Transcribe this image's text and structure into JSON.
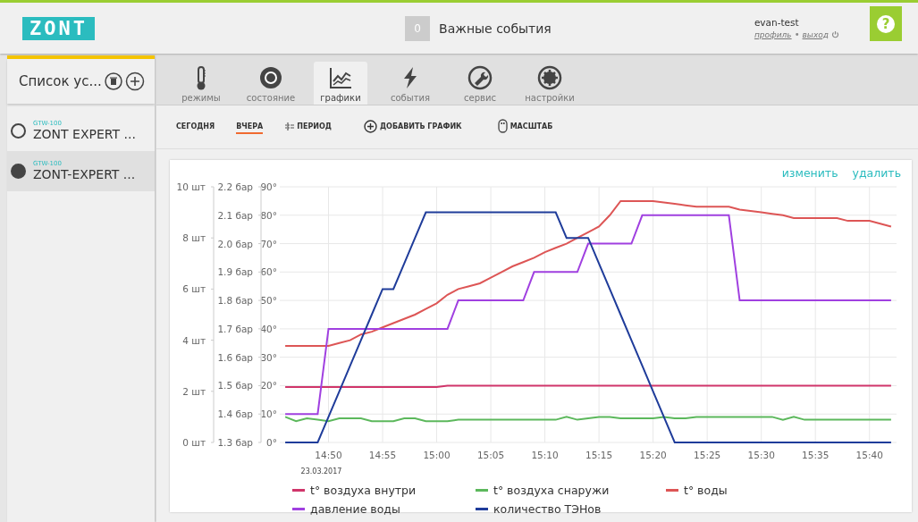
{
  "header": {
    "logo": "ZONT",
    "events": {
      "count": "0",
      "label": "Важные события"
    },
    "user": {
      "name": "evan-test",
      "profile_link": "профиль",
      "separator": "•",
      "logout_link": "выход"
    },
    "help": "?"
  },
  "sidebar": {
    "title": "Список ус...",
    "devices": [
      {
        "model": "GTW-100",
        "name": "ZONT EXPERT ...",
        "selected": false
      },
      {
        "model": "GTW-100",
        "name": "ZONT-EXPERT ...",
        "selected": true
      }
    ]
  },
  "tabs": [
    {
      "kind": "thermometer",
      "label": "режимы",
      "selected": false
    },
    {
      "kind": "status",
      "label": "состояние",
      "selected": false
    },
    {
      "kind": "chart",
      "label": "графики",
      "selected": true
    },
    {
      "kind": "bolt",
      "label": "события",
      "selected": false
    },
    {
      "kind": "wrench",
      "label": "сервис",
      "selected": false
    },
    {
      "kind": "gear",
      "label": "настройки",
      "selected": false
    }
  ],
  "toolbar": [
    {
      "kind": "plain",
      "label": "СЕГОДНЯ",
      "selected": false
    },
    {
      "kind": "plain",
      "label": "ВЧЕРА",
      "selected": true
    },
    {
      "kind": "period",
      "label": "ПЕРИОД",
      "selected": false
    },
    {
      "kind": "add",
      "label": "ДОБАВИТЬ ГРАФИК",
      "selected": false
    },
    {
      "kind": "zoom",
      "label": "МАСШТАБ",
      "selected": false
    }
  ],
  "chart_panel": {
    "actions": [
      "изменить",
      "удалить"
    ],
    "date_label": "23.03.2017",
    "chart_data": {
      "type": "line",
      "grid": true,
      "categories": [
        null,
        null,
        null,
        null,
        "14:50",
        null,
        null,
        null,
        null,
        "14:55",
        null,
        null,
        null,
        null,
        "15:00",
        null,
        null,
        null,
        null,
        "15:05",
        null,
        null,
        null,
        null,
        "15:10",
        null,
        null,
        null,
        null,
        "15:15",
        null,
        null,
        null,
        null,
        "15:20",
        null,
        null,
        null,
        null,
        "15:25",
        null,
        null,
        null,
        null,
        "15:30",
        null,
        null,
        null,
        null,
        "15:35",
        null,
        null,
        null,
        null,
        "15:40",
        null,
        null
      ],
      "ylim": [
        0,
        90
      ],
      "yticks": [
        {
          "value": 0,
          "label": "0°"
        },
        {
          "value": 10,
          "label": "10°"
        },
        {
          "value": 20,
          "label": "20°"
        },
        {
          "value": 30,
          "label": "30°"
        },
        {
          "value": 40,
          "label": "40°"
        },
        {
          "value": 50,
          "label": "50°"
        },
        {
          "value": 60,
          "label": "60°"
        },
        {
          "value": 70,
          "label": "70°"
        },
        {
          "value": 80,
          "label": "80°"
        },
        {
          "value": 90,
          "label": "90°"
        }
      ],
      "y2lim": [
        1.3,
        2.2
      ],
      "y2ticks": [
        {
          "value": 1.3,
          "label": "1.3 бар"
        },
        {
          "value": 1.4,
          "label": "1.4 бар"
        },
        {
          "value": 1.5,
          "label": "1.5 бар"
        },
        {
          "value": 1.6,
          "label": "1.6 бар"
        },
        {
          "value": 1.7,
          "label": "1.7 бар"
        },
        {
          "value": 1.8,
          "label": "1.8 бар"
        },
        {
          "value": 1.9,
          "label": "1.9 бар"
        },
        {
          "value": 2.0,
          "label": "2.0 бар"
        },
        {
          "value": 2.1,
          "label": "2.1 бар"
        },
        {
          "value": 2.2,
          "label": "2.2 бар"
        }
      ],
      "y3lim": [
        0,
        10
      ],
      "y3ticks": [
        {
          "value": 0,
          "label": "0 шт"
        },
        {
          "value": 2,
          "label": "2 шт"
        },
        {
          "value": 4,
          "label": "4 шт"
        },
        {
          "value": 6,
          "label": "6 шт"
        },
        {
          "value": 8,
          "label": "8 шт"
        },
        {
          "value": 10,
          "label": "10 шт"
        }
      ],
      "series": [
        {
          "name": "t° воздуха внутри",
          "color": "#d0356a",
          "values": [
            19.5,
            19.5,
            19.5,
            19.5,
            19.5,
            19.5,
            19.5,
            19.5,
            19.5,
            19.5,
            19.5,
            19.5,
            19.5,
            19.5,
            19.5,
            20,
            20,
            20,
            20,
            20,
            20,
            20,
            20,
            20,
            20,
            20,
            20,
            20,
            20,
            20,
            20,
            20,
            20,
            20,
            20,
            20,
            20,
            20,
            20,
            20,
            20,
            20,
            20,
            20,
            20,
            20,
            20,
            20,
            20,
            20,
            20,
            20,
            20,
            20,
            20,
            20,
            20
          ]
        },
        {
          "name": "t° воздуха снаружи",
          "color": "#5cb85c",
          "values": [
            9,
            7.5,
            8.5,
            8,
            7.5,
            8.5,
            8.5,
            8.5,
            7.5,
            7.5,
            7.5,
            8.5,
            8.5,
            7.5,
            7.5,
            7.5,
            8,
            8,
            8,
            8,
            8,
            8,
            8,
            8,
            8,
            8,
            9,
            8,
            8.5,
            9,
            9,
            8.5,
            8.5,
            8.5,
            8.5,
            9,
            8.5,
            8.5,
            9,
            9,
            9,
            9,
            9,
            9,
            9,
            9,
            8,
            9,
            8,
            8,
            8,
            8,
            8,
            8,
            8,
            8,
            8
          ]
        },
        {
          "name": "t° воды",
          "color": "#dd5555",
          "values": [
            34,
            34,
            34,
            34,
            34,
            35,
            36,
            38,
            39,
            40.5,
            42,
            43.5,
            45,
            47,
            49,
            52,
            54,
            55,
            56,
            58,
            60,
            62,
            63.5,
            65,
            67,
            68.5,
            70,
            72,
            74,
            76,
            80,
            85,
            85,
            85,
            85,
            84.5,
            84,
            83.5,
            83,
            83,
            83,
            83,
            82,
            81.5,
            81,
            80.5,
            80,
            79,
            79,
            79,
            79,
            79,
            78,
            78,
            78,
            77,
            76
          ]
        },
        {
          "name": "давление воды",
          "color": "#a040e0",
          "axis": "y2",
          "values": [
            1.4,
            1.4,
            1.4,
            1.4,
            1.7,
            1.7,
            1.7,
            1.7,
            1.7,
            1.7,
            1.7,
            1.7,
            1.7,
            1.7,
            1.7,
            1.7,
            1.8,
            1.8,
            1.8,
            1.8,
            1.8,
            1.8,
            1.8,
            1.9,
            1.9,
            1.9,
            1.9,
            1.9,
            2.0,
            2.0,
            2.0,
            2.0,
            2.0,
            2.1,
            2.1,
            2.1,
            2.1,
            2.1,
            2.1,
            2.1,
            2.1,
            2.1,
            1.8,
            1.8,
            1.8,
            1.8,
            1.8,
            1.8,
            1.8,
            1.8,
            1.8,
            1.8,
            1.8,
            1.8,
            1.8,
            1.8,
            1.8
          ]
        },
        {
          "name": "количество ТЭНов",
          "color": "#1f3c9a",
          "axis": "y3",
          "values": [
            0,
            0,
            0,
            0,
            1,
            2,
            3,
            4,
            5,
            6,
            6,
            7,
            8,
            9,
            9,
            9,
            9,
            9,
            9,
            9,
            9,
            9,
            9,
            9,
            9,
            9,
            8,
            8,
            8,
            7,
            6,
            5,
            4,
            3,
            2,
            1,
            0,
            0,
            0,
            0,
            0,
            0,
            0,
            0,
            0,
            0,
            0,
            0,
            0,
            0,
            0,
            0,
            0,
            0,
            0,
            0,
            0
          ]
        }
      ]
    }
  }
}
